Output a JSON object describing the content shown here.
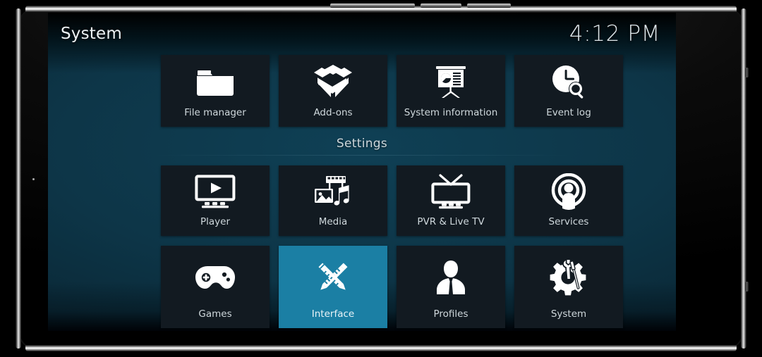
{
  "window": {
    "title": "System",
    "clock": "4:12 PM"
  },
  "theme": {
    "accent": "#1b7fa4",
    "tile_background": "#121a21",
    "text_primary": "#eef2f4",
    "text_secondary": "#cfd8dc",
    "screen_background": "#0d3547"
  },
  "main": {
    "section_heading": "Settings",
    "rows": [
      {
        "id": "row-top",
        "tiles": [
          {
            "label": "File manager",
            "icon": "folder-icon",
            "selected": false
          },
          {
            "label": "Add-ons",
            "icon": "open-box-icon",
            "selected": false
          },
          {
            "label": "System information",
            "icon": "presentation-chart-icon",
            "selected": false
          },
          {
            "label": "Event log",
            "icon": "clock-search-icon",
            "selected": false
          }
        ]
      },
      {
        "id": "row-mid",
        "tiles": [
          {
            "label": "Player",
            "icon": "monitor-play-icon",
            "selected": false
          },
          {
            "label": "Media",
            "icon": "photo-film-music-icon",
            "selected": false
          },
          {
            "label": "PVR & Live TV",
            "icon": "television-icon",
            "selected": false
          },
          {
            "label": "Services",
            "icon": "broadcast-person-icon",
            "selected": false
          }
        ]
      },
      {
        "id": "row-bot",
        "tiles": [
          {
            "label": "Games",
            "icon": "gamepad-icon",
            "selected": false
          },
          {
            "label": "Interface",
            "icon": "pencil-ruler-icon",
            "selected": true
          },
          {
            "label": "Profiles",
            "icon": "user-silhouette-icon",
            "selected": false
          },
          {
            "label": "System",
            "icon": "gear-wrench-icon",
            "selected": false
          }
        ]
      }
    ]
  }
}
